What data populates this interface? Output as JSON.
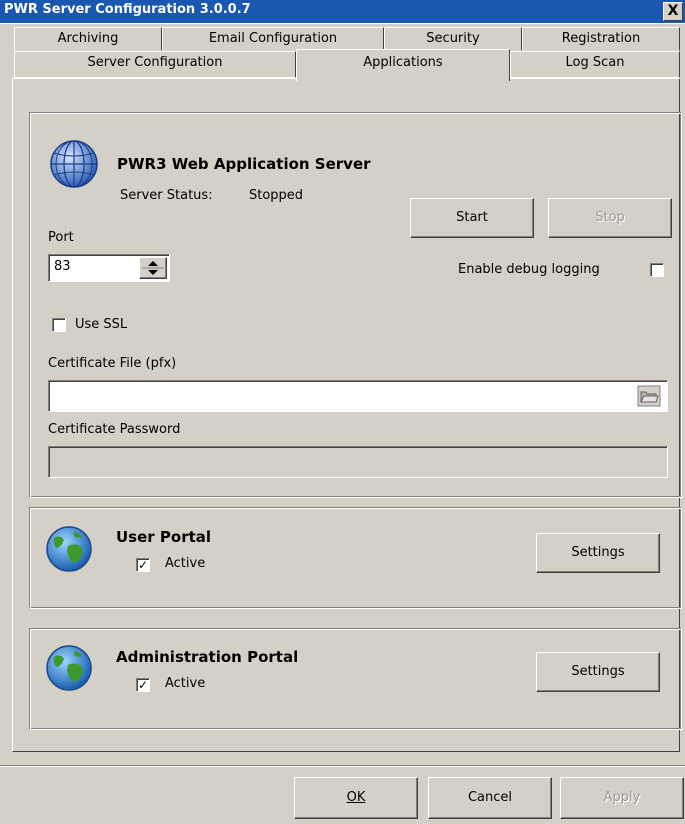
{
  "window": {
    "title": "PWR Server Configuration 3.0.0.7",
    "close_label": "X"
  },
  "tabs": {
    "row1": [
      "Archiving",
      "Email Configuration",
      "Security",
      "Registration"
    ],
    "row2": [
      "Server Configuration",
      "Applications",
      "Log Scan"
    ],
    "active": "Applications"
  },
  "web_server": {
    "title": "PWR3 Web Application Server",
    "status_label": "Server Status:",
    "status_value": "Stopped",
    "start_label": "Start",
    "stop_label": "Stop",
    "port_label": "Port",
    "port_value": "83",
    "debug_label": "Enable debug logging",
    "debug_checked": false,
    "ssl_label": "Use SSL",
    "ssl_checked": false,
    "cert_file_label": "Certificate File (pfx)",
    "cert_file_value": "",
    "cert_password_label": "Certificate Password",
    "cert_password_value": ""
  },
  "user_portal": {
    "title": "User Portal",
    "active_label": "Active",
    "active_checked": true,
    "settings_label": "Settings"
  },
  "admin_portal": {
    "title": "Administration Portal",
    "active_label": "Active",
    "active_checked": true,
    "settings_label": "Settings"
  },
  "footer": {
    "ok_label": "OK",
    "cancel_label": "Cancel",
    "apply_label": "Apply"
  },
  "colors": {
    "titlebar": "#1a57b0",
    "face": "#d4d0c8"
  },
  "icons": {
    "web_server": "globe-wireframe-icon",
    "portal": "earth-globe-icon",
    "browse": "folder-open-icon",
    "spinner": "spinner-arrows-icon"
  }
}
